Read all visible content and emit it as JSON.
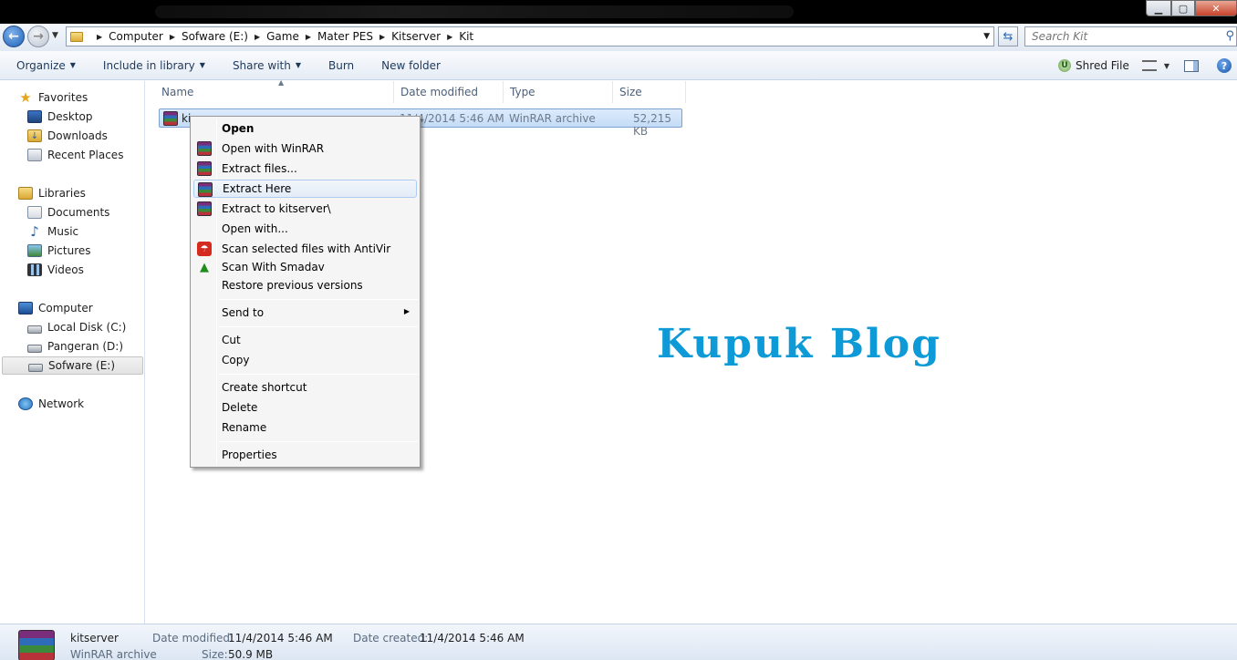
{
  "window": {
    "buttons": {
      "minimize": "▁",
      "maximize": "▢",
      "close": "✕"
    }
  },
  "address": {
    "path": [
      "Computer",
      "Sofware (E:)",
      "Game",
      "Mater PES",
      "Kitserver",
      "Kit"
    ],
    "search_placeholder": "Search Kit"
  },
  "toolbar": {
    "items": [
      {
        "label": "Organize",
        "dropdown": true
      },
      {
        "label": "Include in library",
        "dropdown": true
      },
      {
        "label": "Share with",
        "dropdown": true
      },
      {
        "label": "Burn",
        "dropdown": false
      },
      {
        "label": "New folder",
        "dropdown": false
      }
    ],
    "shred_file": "Shred File"
  },
  "nav": {
    "favorites": {
      "label": "Favorites",
      "children": [
        "Desktop",
        "Downloads",
        "Recent Places"
      ]
    },
    "libraries": {
      "label": "Libraries",
      "children": [
        "Documents",
        "Music",
        "Pictures",
        "Videos"
      ]
    },
    "computer": {
      "label": "Computer",
      "children": [
        "Local Disk (C:)",
        "Pangeran (D:)",
        "Sofware (E:)"
      ]
    },
    "network": {
      "label": "Network"
    }
  },
  "columns": [
    "Name",
    "Date modified",
    "Type",
    "Size"
  ],
  "file": {
    "name": "kitserver",
    "name_visible": "ki",
    "date_visible": "11/4/2014 5:46 AM",
    "type": "WinRAR archive",
    "size": "52,215 KB"
  },
  "watermark": "Kupuk Blog",
  "context_menu": {
    "open": "Open",
    "open_winrar": "Open with WinRAR",
    "extract_files": "Extract files...",
    "extract_here": "Extract Here",
    "extract_to": "Extract to kitserver\\",
    "open_with": "Open with...",
    "scan_antivir": "Scan selected files with AntiVir",
    "scan_smadav": "Scan With Smadav",
    "restore": "Restore previous versions",
    "send_to": "Send to",
    "cut": "Cut",
    "copy": "Copy",
    "create_shortcut": "Create shortcut",
    "delete": "Delete",
    "rename": "Rename",
    "properties": "Properties",
    "hovered": "Extract Here"
  },
  "details": {
    "name": "kitserver",
    "type": "WinRAR archive",
    "date_modified_label": "Date modified:",
    "date_modified": "11/4/2014 5:46 AM",
    "size_label": "Size:",
    "size": "50.9 MB",
    "date_created_label": "Date created:",
    "date_created": "11/4/2014 5:46 AM"
  },
  "colors": {
    "watermark": "#0e9ad6",
    "selection": "#c4dcf7"
  }
}
